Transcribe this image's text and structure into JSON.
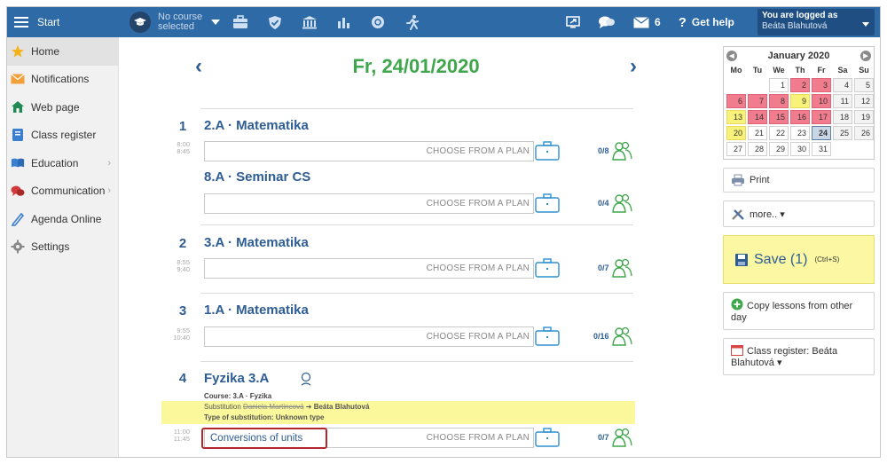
{
  "topbar": {
    "start_label": "Start",
    "course_label_1": "No course",
    "course_label_2": "selected",
    "help_label": "Get help",
    "messages_count": "6",
    "logged_line1": "You are logged as",
    "logged_line2": "Beáta Blahutová",
    "bg_color": "#2e6aa6"
  },
  "sidebar": {
    "items": [
      {
        "label": "Home",
        "icon": "star-icon"
      },
      {
        "label": "Notifications",
        "icon": "envelope-icon"
      },
      {
        "label": "Web page",
        "icon": "house-icon"
      },
      {
        "label": "Class register",
        "icon": "book-icon"
      },
      {
        "label": "Education",
        "icon": "open-book-icon"
      },
      {
        "label": "Communication",
        "icon": "chat-icon"
      },
      {
        "label": "Agenda Online",
        "icon": "pencil-icon"
      },
      {
        "label": "Settings",
        "icon": "gear-icon"
      }
    ]
  },
  "main": {
    "date_title": "Fr, 24/01/2020",
    "prev_arrow": "‹",
    "next_arrow": "›",
    "choose_label": "CHOOSE FROM A PLAN",
    "hours": [
      {
        "num": "1",
        "time_from": "8:00",
        "time_to": "8:45"
      },
      {
        "num": "2",
        "time_from": "8:55",
        "time_to": "9:40"
      },
      {
        "num": "3",
        "time_from": "9:55",
        "time_to": "10:40"
      },
      {
        "num": "4",
        "time_from": "11:00",
        "time_to": "11:45"
      }
    ],
    "lessons": [
      {
        "title": "2.A · Matematika",
        "attendance": "0/8"
      },
      {
        "title": "8.A · Seminar CS",
        "attendance": "0/4"
      },
      {
        "title": "3.A · Matematika",
        "attendance": "0/7"
      },
      {
        "title": "1.A · Matematika",
        "attendance": "0/16"
      },
      {
        "title": "Fyzika  3.A",
        "attendance": "0/7",
        "typed_topic": "Conversions of units"
      }
    ],
    "fyzika": {
      "course_line": "Course:  3.A · Fyzika",
      "subst_label": "Substitution",
      "subst_from": "Daniela Martincová",
      "subst_arrow": "➔",
      "subst_to": "Beáta Blahutová",
      "subst_type": "Type of substitution:  Unknown type"
    }
  },
  "calendar": {
    "month_label": "January 2020",
    "dow": [
      "Mo",
      "Tu",
      "We",
      "Th",
      "Fr",
      "Sa",
      "Su"
    ],
    "weeks": [
      [
        {
          "d": "",
          "t": "empty"
        },
        {
          "d": "",
          "t": "empty"
        },
        {
          "d": "1",
          "t": ""
        },
        {
          "d": "2",
          "t": "red"
        },
        {
          "d": "3",
          "t": "red"
        },
        {
          "d": "4",
          "t": "weekend"
        },
        {
          "d": "5",
          "t": "weekend"
        }
      ],
      [
        {
          "d": "6",
          "t": "red"
        },
        {
          "d": "7",
          "t": "red"
        },
        {
          "d": "8",
          "t": "red"
        },
        {
          "d": "9",
          "t": "yellow"
        },
        {
          "d": "10",
          "t": "red"
        },
        {
          "d": "11",
          "t": "weekend"
        },
        {
          "d": "12",
          "t": "weekend"
        }
      ],
      [
        {
          "d": "13",
          "t": "yellow"
        },
        {
          "d": "14",
          "t": "red"
        },
        {
          "d": "15",
          "t": "red"
        },
        {
          "d": "16",
          "t": "red"
        },
        {
          "d": "17",
          "t": "red"
        },
        {
          "d": "18",
          "t": "weekend"
        },
        {
          "d": "19",
          "t": "weekend"
        }
      ],
      [
        {
          "d": "20",
          "t": "yellow"
        },
        {
          "d": "21",
          "t": ""
        },
        {
          "d": "22",
          "t": ""
        },
        {
          "d": "23",
          "t": ""
        },
        {
          "d": "24",
          "t": "today"
        },
        {
          "d": "25",
          "t": "weekend"
        },
        {
          "d": "26",
          "t": "weekend"
        }
      ],
      [
        {
          "d": "27",
          "t": ""
        },
        {
          "d": "28",
          "t": ""
        },
        {
          "d": "29",
          "t": ""
        },
        {
          "d": "30",
          "t": ""
        },
        {
          "d": "31",
          "t": ""
        },
        {
          "d": "",
          "t": "empty"
        },
        {
          "d": "",
          "t": "empty"
        }
      ]
    ]
  },
  "right_panel": {
    "print_label": "Print",
    "more_label": "more.. ▾",
    "save_label": "Save (1)",
    "save_shortcut": "(Ctrl+S)",
    "copy_label": "Copy lessons from other day",
    "class_register_label": "Class register: Beáta Blahutová ▾"
  }
}
